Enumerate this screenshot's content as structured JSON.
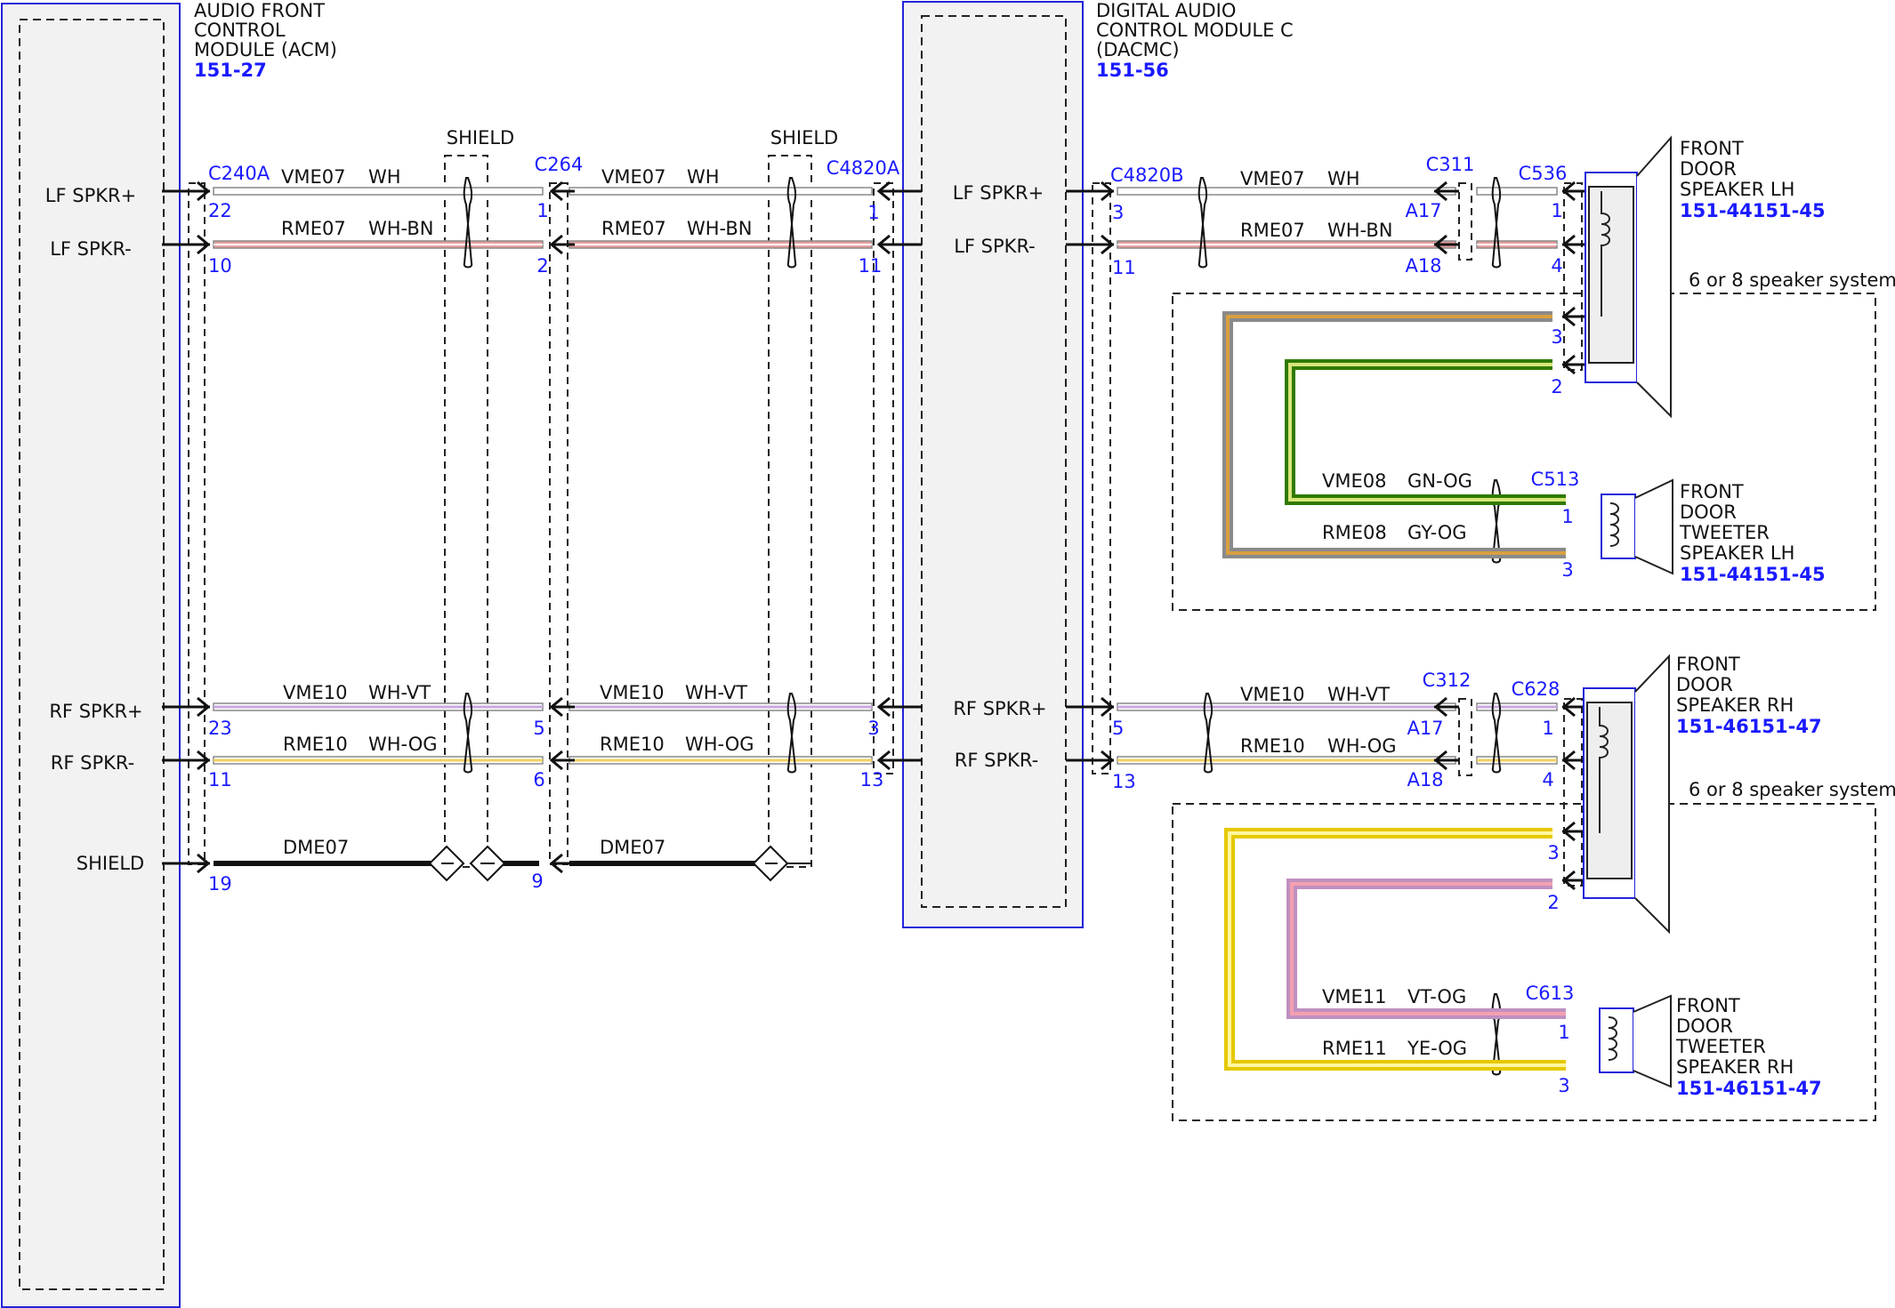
{
  "colors": {
    "module_border": "#2323d9",
    "module_fill": "#f2f2f2",
    "blue_text": "#1a1aff",
    "wire_WH": "#c8c8c8",
    "wire_BN_stripe": "#e8a0a0",
    "wire_VT_stripe": "#c9a9e0",
    "wire_OG_stripe": "#f0d060",
    "gn_og_outer": "#2f7a00",
    "gn_og_inner": "#d7e57a",
    "gy_og_outer": "#8a8a8a",
    "gy_og_inner": "#d8a040",
    "vt_og_outer": "#c090c0",
    "vt_og_inner": "#f4a0b0",
    "ye_og_outer": "#e6c800",
    "ye_og_inner": "#fff7a0"
  },
  "modules": {
    "acm": {
      "title_lines": [
        "AUDIO FRONT",
        "CONTROL",
        "MODULE (ACM)"
      ],
      "ref": "151-27",
      "pins": [
        "LF SPKR+",
        "LF SPKR-",
        "RF SPKR+",
        "RF SPKR-",
        "SHIELD"
      ]
    },
    "dacmc": {
      "title_lines": [
        "DIGITAL AUDIO",
        "CONTROL MODULE C",
        "(DACMC)"
      ],
      "ref": "151-56",
      "pins": [
        "LF SPKR+",
        "LF SPKR-",
        "RF SPKR+",
        "RF SPKR-"
      ]
    }
  },
  "shields": [
    "SHIELD",
    "SHIELD"
  ],
  "connectors": {
    "c240a": {
      "name": "C240A",
      "pins": [
        "22",
        "10",
        "23",
        "11",
        "19"
      ]
    },
    "c264": {
      "name": "C264",
      "pins": [
        "1",
        "2",
        "5",
        "6",
        "9"
      ]
    },
    "c4820a": {
      "name": "C4820A",
      "pins": [
        "1",
        "11",
        "3",
        "13"
      ]
    },
    "c4820b": {
      "name": "C4820B",
      "pins": [
        "3",
        "11",
        "5",
        "13"
      ]
    },
    "c311": {
      "name": "C311",
      "pins": [
        "A17",
        "A18"
      ]
    },
    "c536": {
      "name": "C536",
      "pins": [
        "1",
        "4",
        "3",
        "2"
      ]
    },
    "c513": {
      "name": "C513",
      "pins": [
        "1",
        "3"
      ]
    },
    "c312": {
      "name": "C312",
      "pins": [
        "A17",
        "A18"
      ]
    },
    "c628": {
      "name": "C628",
      "pins": [
        "1",
        "4",
        "3",
        "2"
      ]
    },
    "c613": {
      "name": "C613",
      "pins": [
        "1",
        "3"
      ]
    }
  },
  "wires": {
    "vme07": {
      "circuit": "VME07",
      "color": "WH"
    },
    "rme07": {
      "circuit": "RME07",
      "color": "WH-BN"
    },
    "vme10": {
      "circuit": "VME10",
      "color": "WH-VT"
    },
    "rme10": {
      "circuit": "RME10",
      "color": "WH-OG"
    },
    "dme07": {
      "circuit": "DME07"
    },
    "vme08": {
      "circuit": "VME08",
      "color": "GN-OG"
    },
    "rme08": {
      "circuit": "RME08",
      "color": "GY-OG"
    },
    "vme11": {
      "circuit": "VME11",
      "color": "VT-OG"
    },
    "rme11": {
      "circuit": "RME11",
      "color": "YE-OG"
    }
  },
  "speakers": {
    "lf_speaker": {
      "lines": [
        "FRONT",
        "DOOR",
        "SPEAKER LH"
      ],
      "ref": "151-44151-45"
    },
    "lf_tweeter": {
      "lines": [
        "FRONT",
        "DOOR",
        "TWEETER",
        "SPEAKER LH"
      ],
      "ref": "151-44151-45"
    },
    "rf_speaker": {
      "lines": [
        "FRONT",
        "DOOR",
        "SPEAKER RH"
      ],
      "ref": "151-46151-47"
    },
    "rf_tweeter": {
      "lines": [
        "FRONT",
        "DOOR",
        "TWEETER",
        "SPEAKER RH"
      ],
      "ref": "151-46151-47"
    }
  },
  "options": {
    "lf_system_label": "6 or 8 speaker system",
    "rf_system_label": "6 or 8 speaker system"
  }
}
